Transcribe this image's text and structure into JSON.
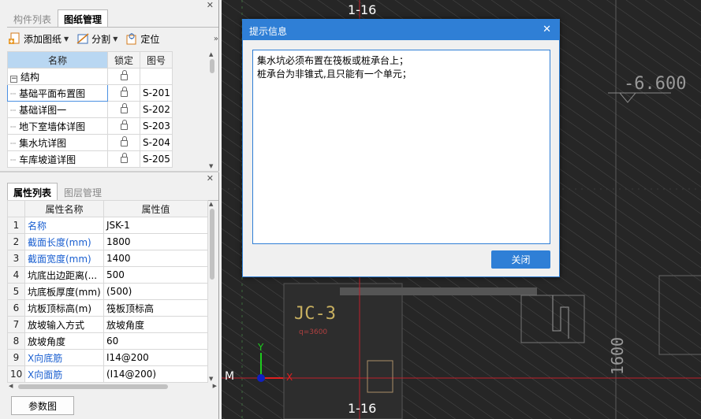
{
  "drawing_panel": {
    "tabs": [
      "构件列表",
      "图纸管理"
    ],
    "active_tab": 1,
    "toolbar": {
      "add": "添加图纸",
      "split": "分割",
      "locate": "定位"
    },
    "columns": [
      "名称",
      "锁定",
      "图号"
    ],
    "group": "结构",
    "rows": [
      {
        "name": "基础平面布置图",
        "num": "S-201"
      },
      {
        "name": "基础详图一",
        "num": "S-202"
      },
      {
        "name": "地下室墙体详图",
        "num": "S-203"
      },
      {
        "name": "集水坑详图",
        "num": "S-204"
      },
      {
        "name": "车库坡道详图",
        "num": "S-205"
      }
    ]
  },
  "property_panel": {
    "tabs": [
      "属性列表",
      "图层管理"
    ],
    "columns": [
      "属性名称",
      "属性值"
    ],
    "rows": [
      {
        "n": "1",
        "name": "名称",
        "value": "JSK-1"
      },
      {
        "n": "2",
        "name": "截面长度(mm)",
        "value": "1800"
      },
      {
        "n": "3",
        "name": "截面宽度(mm)",
        "value": "1400"
      },
      {
        "n": "4",
        "name": "坑底出边距离(...",
        "value": "500"
      },
      {
        "n": "5",
        "name": "坑底板厚度(mm)",
        "value": "(500)"
      },
      {
        "n": "6",
        "name": "坑板顶标高(m)",
        "value": "筏板顶标高"
      },
      {
        "n": "7",
        "name": "放坡输入方式",
        "value": "放坡角度"
      },
      {
        "n": "8",
        "name": "放坡角度",
        "value": "60"
      },
      {
        "n": "9",
        "name": "X向底筋",
        "value": "Ⅰ14@200"
      },
      {
        "n": "10",
        "name": "X向面筋",
        "value": "(Ⅰ14@200)"
      }
    ],
    "bottom_button": "参数图"
  },
  "canvas": {
    "top_label": "1-16",
    "bottom_label": "1-16",
    "elevation": "-6.600",
    "component_label": "JC-3",
    "component_sub": "q=3600",
    "dimension": "1600",
    "axis_m": "M",
    "axis_x": "X",
    "axis_y": "Y"
  },
  "dialog": {
    "title": "提示信息",
    "line1": "集水坑必须布置在筏板或桩承台上；",
    "line2": "桩承台为非锥式,且只能有一个单元；",
    "ok": "关闭"
  }
}
